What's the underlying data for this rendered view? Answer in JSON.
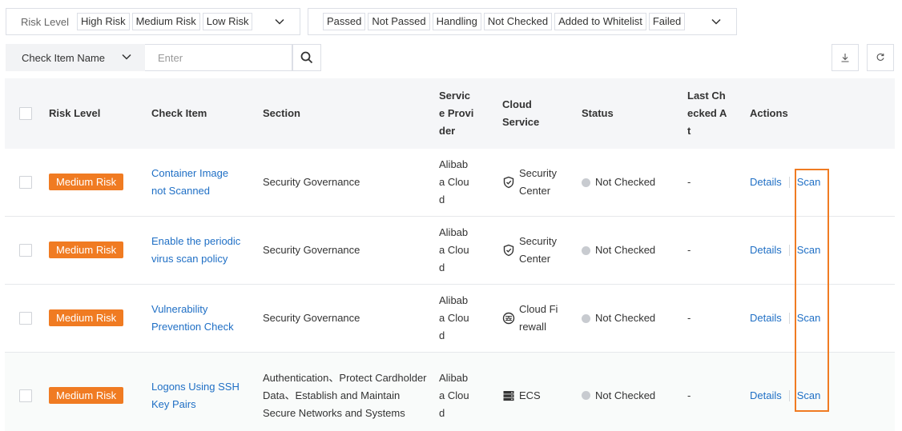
{
  "risk_filter": {
    "label": "Risk Level",
    "options": [
      "High Risk",
      "Medium Risk",
      "Low Risk"
    ]
  },
  "status_filter": {
    "options": [
      "Passed",
      "Not Passed",
      "Handling",
      "Not Checked",
      "Added to Whitelist",
      "Failed"
    ]
  },
  "search": {
    "field": "Check Item Name",
    "placeholder": "Enter"
  },
  "table": {
    "columns": {
      "risk": "Risk Level",
      "item": "Check Item",
      "section": "Section",
      "provider": "Service Provider",
      "cloud": "Cloud Service",
      "status": "Status",
      "last": "Last Checked At",
      "actions": "Actions"
    },
    "rows": [
      {
        "risk": "Medium Risk",
        "item": "Container Image not Scanned",
        "section": "Security Governance",
        "provider": "Alibaba Cloud",
        "cloud": "Security Center",
        "cloud_icon": "shield-icon",
        "status": "Not Checked",
        "last": "-",
        "details": "Details",
        "scan": "Scan"
      },
      {
        "risk": "Medium Risk",
        "item": "Enable the periodic virus scan policy",
        "section": "Security Governance",
        "provider": "Alibaba Cloud",
        "cloud": "Security Center",
        "cloud_icon": "shield-icon",
        "status": "Not Checked",
        "last": "-",
        "details": "Details",
        "scan": "Scan"
      },
      {
        "risk": "Medium Risk",
        "item": "Vulnerability Prevention Check",
        "section": "Security Governance",
        "provider": "Alibaba Cloud",
        "cloud": "Cloud Firewall",
        "cloud_icon": "firewall-icon",
        "status": "Not Checked",
        "last": "-",
        "details": "Details",
        "scan": "Scan"
      },
      {
        "risk": "Medium Risk",
        "item": "Logons Using SSH Key Pairs",
        "section": "Authentication、Protect Cardholder Data、Establish and Maintain Secure Networks and Systems",
        "provider": "Alibaba Cloud",
        "cloud": "ECS",
        "cloud_icon": "server-icon",
        "status": "Not Checked",
        "last": "-",
        "details": "Details",
        "scan": "Scan"
      }
    ]
  },
  "colors": {
    "badge_medium": "#f07b22",
    "link": "#1f6fc5",
    "highlight": "#f07b22",
    "header_bg": "#f5f6f8"
  }
}
